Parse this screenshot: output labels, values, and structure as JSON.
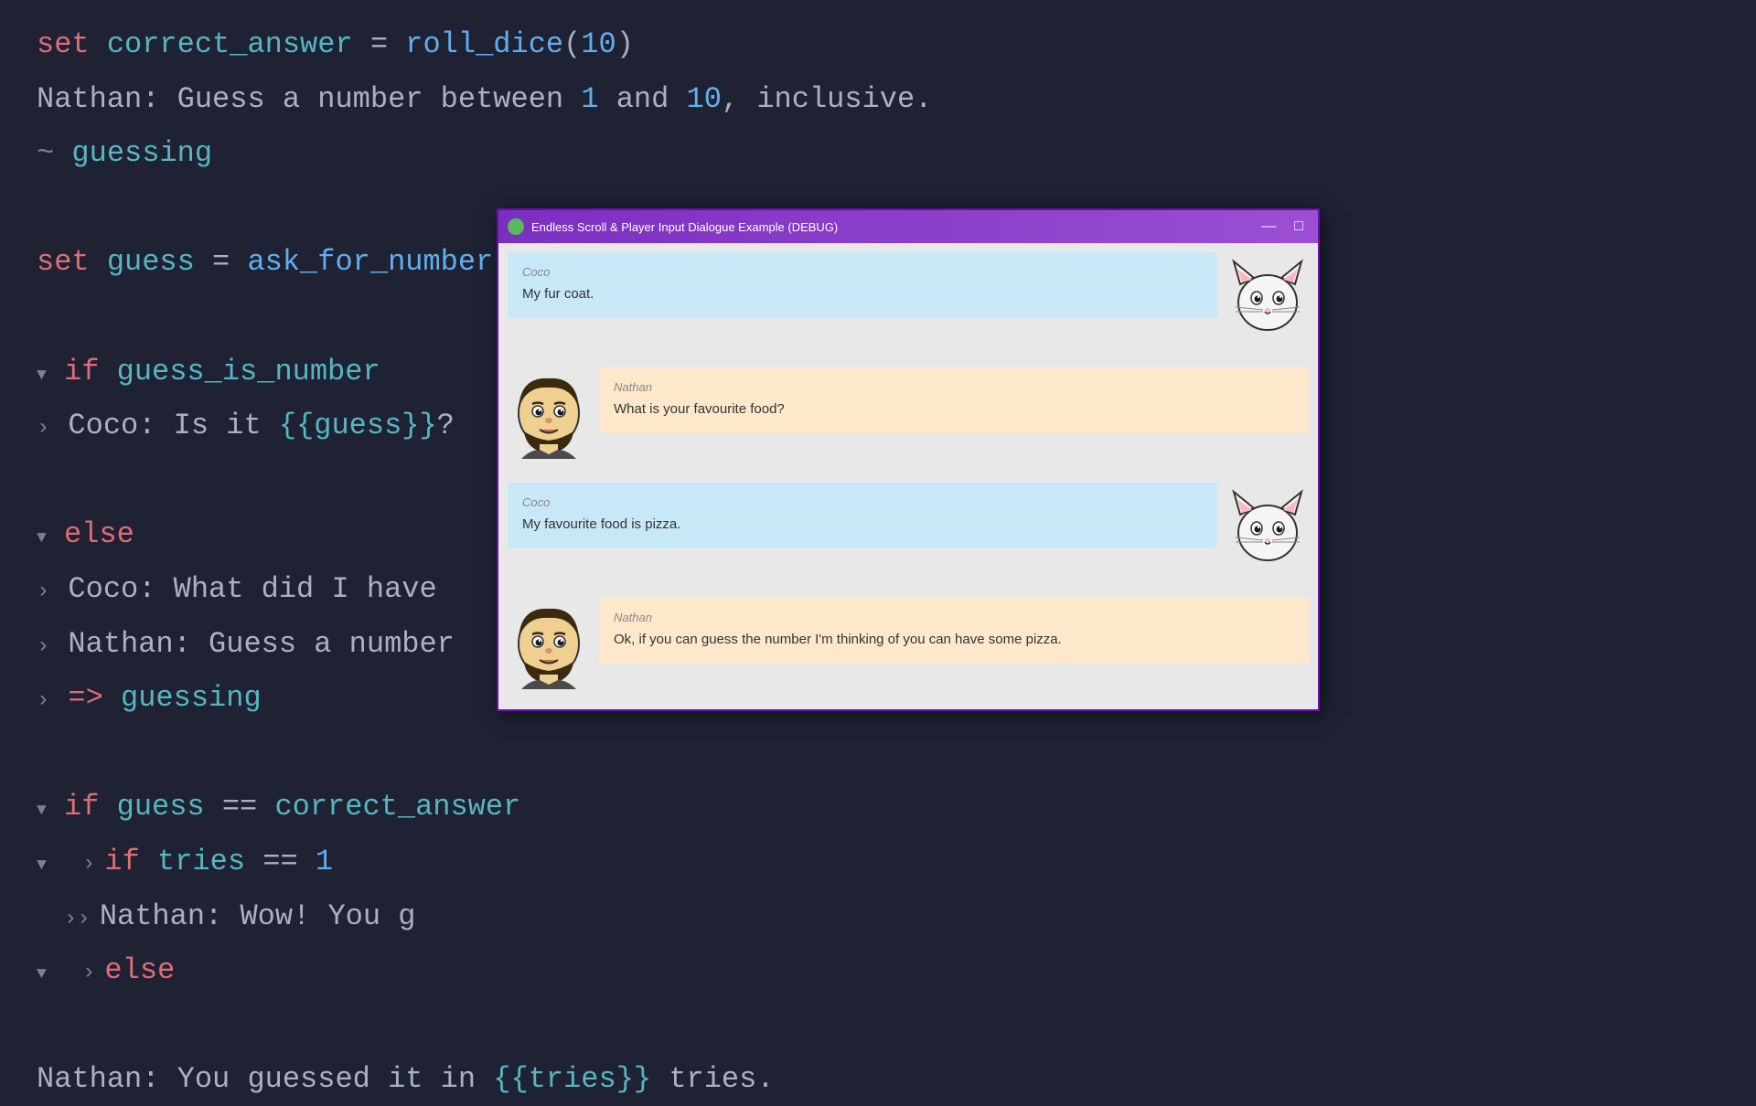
{
  "window": {
    "title": "Endless Scroll & Player Input Dialogue Example (DEBUG)",
    "icon_color": "#5cb85c"
  },
  "titlebar": {
    "minimize_label": "—",
    "maximize_label": "□"
  },
  "code_lines": [
    {
      "id": "line1",
      "text": "set correct_answer = roll_dice(10)"
    },
    {
      "id": "line2",
      "text": "Nathan: Guess a number between 1 and 10, inclusive."
    },
    {
      "id": "line3",
      "text": "~ guessing"
    },
    {
      "id": "line4",
      "text": ""
    },
    {
      "id": "line5",
      "text": "set guess = ask_for_number()"
    },
    {
      "id": "line6",
      "text": ""
    },
    {
      "id": "line7_if",
      "text": "if guess_is_number"
    },
    {
      "id": "line8",
      "text": "    Coco: Is it {{guess}}?"
    },
    {
      "id": "line9",
      "text": ""
    },
    {
      "id": "line10_else",
      "text": "else"
    },
    {
      "id": "line11",
      "text": "    Coco: What did I have"
    },
    {
      "id": "line12",
      "text": "    Nathan: Guess a number"
    },
    {
      "id": "line13",
      "text": "    => guessing"
    },
    {
      "id": "line14",
      "text": ""
    },
    {
      "id": "line15_if2",
      "text": "if guess == correct_answer"
    },
    {
      "id": "line16_iftries",
      "text": "    if tries == 1"
    },
    {
      "id": "line17",
      "text": "        Nathan: Wow! You g"
    },
    {
      "id": "line18_else2",
      "text": "    else"
    },
    {
      "id": "line19",
      "text": "Nathan: You guessed it in {{tries}} tries."
    }
  ],
  "messages": [
    {
      "id": "msg0",
      "speaker": "Coco",
      "text": "My fur coat.",
      "type": "coco"
    },
    {
      "id": "msg1",
      "speaker": "Nathan",
      "text": "What is your favourite food?",
      "type": "nathan"
    },
    {
      "id": "msg2",
      "speaker": "Coco",
      "text": "My favourite food is pizza.",
      "type": "coco"
    },
    {
      "id": "msg3",
      "speaker": "Nathan",
      "text": "Ok, if you can guess the number I'm thinking of you can have some pizza.",
      "type": "nathan"
    }
  ]
}
